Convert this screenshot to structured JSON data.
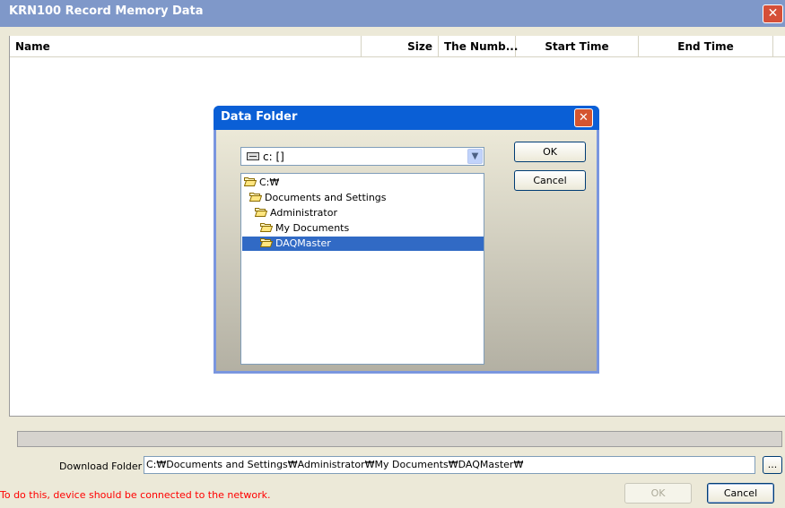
{
  "window": {
    "title": "KRN100 Record Memory Data",
    "close_glyph": "✕"
  },
  "list": {
    "columns": [
      "Name",
      "Size",
      "The Numb...",
      "Start Time",
      "End Time"
    ]
  },
  "dialog": {
    "title": "Data Folder",
    "close_glyph": "✕",
    "drive_value": "c: []",
    "drop_glyph": "▼",
    "tree": [
      "C:₩",
      "Documents and Settings",
      "Administrator",
      "My Documents",
      "DAQMaster"
    ],
    "selected": "DAQMaster",
    "ok_label": "OK",
    "cancel_label": "Cancel"
  },
  "download": {
    "label": "Download Folder",
    "path": "C:₩Documents and Settings₩Administrator₩My Documents₩DAQMaster₩",
    "browse_label": "..."
  },
  "status_text": "To do this, device should be connected to the network.",
  "buttons": {
    "ok_label": "OK",
    "cancel_label": "Cancel"
  },
  "colors": {
    "title_bar": "#7f98c9",
    "dialog_title": "#0a5fd6",
    "selection": "#316ac5",
    "status_text": "#ff0000"
  }
}
